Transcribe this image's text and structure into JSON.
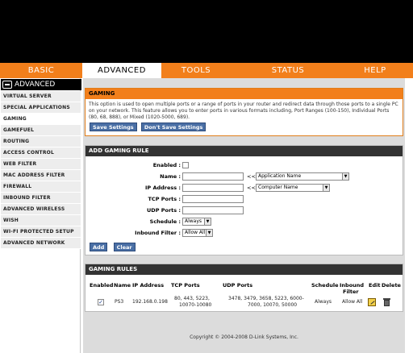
{
  "nav": {
    "tabs": [
      {
        "label": "BASIC"
      },
      {
        "label": "ADVANCED"
      },
      {
        "label": "TOOLS"
      },
      {
        "label": "STATUS"
      },
      {
        "label": "HELP"
      }
    ],
    "active_tab": "ADVANCED"
  },
  "sidebar": {
    "title": "ADVANCED",
    "items": [
      {
        "label": "VIRTUAL SERVER"
      },
      {
        "label": "SPECIAL APPLICATIONS"
      },
      {
        "label": "GAMING"
      },
      {
        "label": "GAMEFUEL"
      },
      {
        "label": "ROUTING"
      },
      {
        "label": "ACCESS CONTROL"
      },
      {
        "label": "WEB FILTER"
      },
      {
        "label": "MAC ADDRESS FILTER"
      },
      {
        "label": "FIREWALL"
      },
      {
        "label": "INBOUND FILTER"
      },
      {
        "label": "ADVANCED WIRELESS"
      },
      {
        "label": "WISH"
      },
      {
        "label": "WI-FI PROTECTED SETUP"
      },
      {
        "label": "ADVANCED NETWORK"
      }
    ],
    "selected": "GAMING"
  },
  "gaming": {
    "title": "GAMING",
    "description": "This option is used to open multiple ports or a range of ports in your router and redirect data through those ports to a single PC on your network. This feature allows you to enter ports in various formats including, Port Ranges (100-150), Individual Ports (80, 68, 888), or Mixed (1020-5000, 689).",
    "save_label": "Save Settings",
    "dont_save_label": "Don't Save Settings"
  },
  "add_rule": {
    "title": "ADD GAMING RULE",
    "enabled_label": "Enabled :",
    "name_label": "Name :",
    "ip_label": "IP Address :",
    "tcp_label": "TCP Ports :",
    "udp_label": "UDP Ports :",
    "schedule_label": "Schedule :",
    "inbound_label": "Inbound Filter :",
    "arrows": "<<",
    "app_name_option": "Application Name",
    "computer_name_option": "Computer Name",
    "schedule_value": "Always",
    "inbound_value": "Allow All",
    "add_label": "Add",
    "clear_label": "Clear"
  },
  "rules": {
    "title": "GAMING RULES",
    "headers": {
      "enabled": "Enabled",
      "name": "Name",
      "ip": "IP Address",
      "tcp": "TCP Ports",
      "udp": "UDP Ports",
      "schedule": "Schedule",
      "inbound_line1": "Inbound",
      "inbound_line2": "Filter",
      "edit": "Edit",
      "delete": "Delete"
    },
    "rows": [
      {
        "enabled": true,
        "name": "PS3",
        "ip": "192.168.0.198",
        "tcp_line1": "80, 443, 5223,",
        "tcp_line2": "10070-10080",
        "udp_line1": "3478, 3479, 3658, 5223, 6000-",
        "udp_line2": "7000, 10070, 50000",
        "schedule": "Always",
        "inbound": "Allow All"
      }
    ]
  },
  "footer": {
    "copyright": "Copyright © 2004-2008 D-Link Systems, Inc."
  }
}
